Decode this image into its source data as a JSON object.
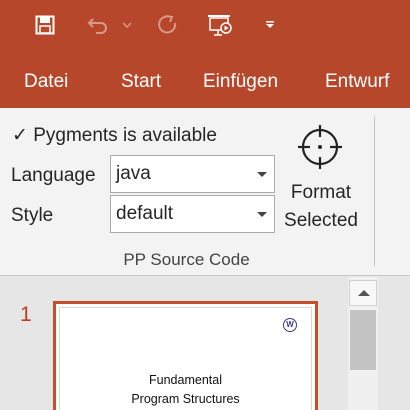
{
  "colors": {
    "accent": "#b7472a",
    "ribbon_bg": "#f3f3f3",
    "slide_number": "#c43e1c"
  },
  "qat": {
    "icons": [
      "save-icon",
      "undo-icon",
      "undo-dropdown-icon",
      "redo-icon",
      "start-from-beginning-icon",
      "customize-toolbar-icon"
    ]
  },
  "tabs": [
    "Datei",
    "Start",
    "Einfügen",
    "Entwurf"
  ],
  "ribbon": {
    "status": "✓ Pygments is available",
    "language_label": "Language",
    "language_value": "java",
    "style_label": "Style",
    "style_value": "default",
    "format_button": {
      "line1": "Format",
      "line2": "Selected"
    },
    "group_label": "PP Source Code"
  },
  "slides": [
    {
      "number": "1",
      "title_line1": "Fundamental",
      "title_line2": "Program Structures",
      "logo": "W"
    }
  ]
}
